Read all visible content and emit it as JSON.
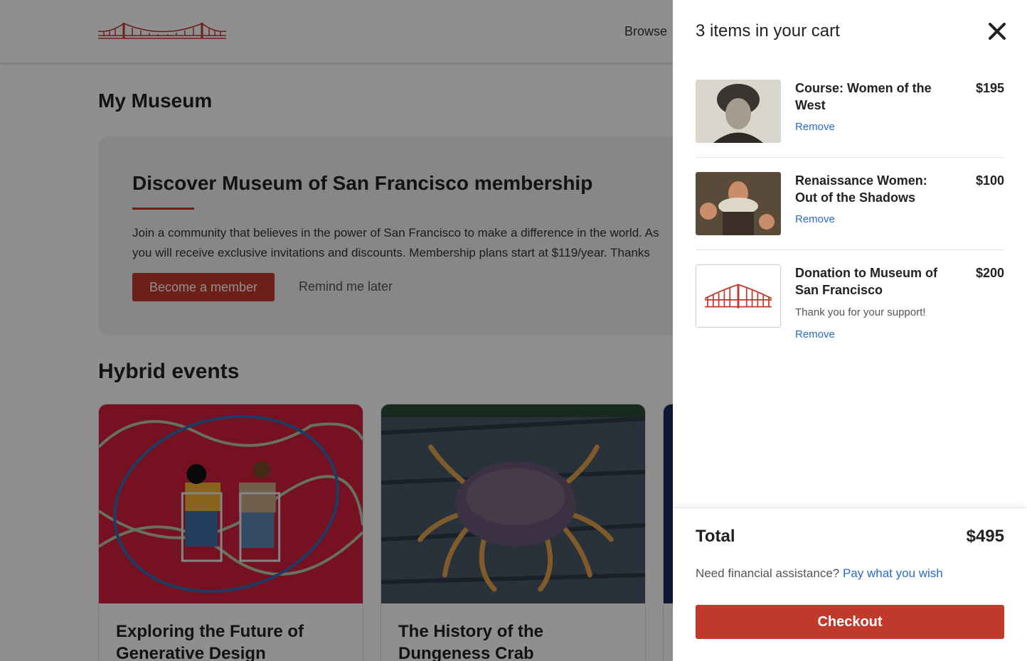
{
  "header": {
    "nav_browse": "Browse"
  },
  "page": {
    "title": "My Museum"
  },
  "promo": {
    "title": "Discover Museum of San Francisco membership",
    "text_line1": "Join a community that believes in the power of San Francisco to make a difference in the world. As",
    "text_line2": "you will receive exclusive invitations and discounts. Membership plans start at $119/year. Thanks",
    "primary_button": "Become a member",
    "secondary_button": "Remind me later"
  },
  "events": {
    "section_title": "Hybrid events",
    "cards": [
      {
        "title": "Exploring the Future of Generative Design"
      },
      {
        "title": "The History of the Dungeness Crab"
      }
    ]
  },
  "cart": {
    "title": "3 items in your cart",
    "items": [
      {
        "name": "Course: Women of the West",
        "price": "$195",
        "remove": "Remove"
      },
      {
        "name": "Renaissance Women: Out of the Shadows",
        "price": "$100",
        "remove": "Remove"
      },
      {
        "name": "Donation to Museum of San Francisco",
        "price": "$200",
        "note": "Thank you for your support!",
        "remove": "Remove"
      }
    ],
    "total_label": "Total",
    "total_value": "$495",
    "assist_text": "Need financial assistance?",
    "assist_link": "Pay what you wish",
    "checkout_label": "Checkout"
  },
  "colors": {
    "brand_red": "#c0392b",
    "link_blue": "#2a6ac8"
  },
  "icons": {
    "logo": "golden-gate-bridge-icon",
    "close": "close-icon"
  }
}
